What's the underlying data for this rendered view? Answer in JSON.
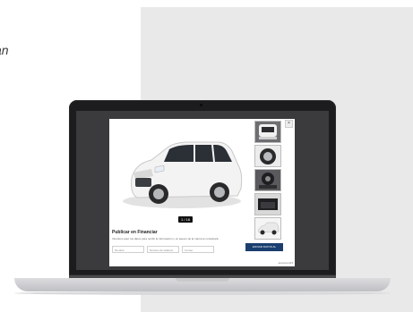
{
  "side_text": "an",
  "modal": {
    "counter": "1 / 18",
    "title": "Publicar en Financiar",
    "subtitle": "Introduce aquí tus datos para recibir la información y un asesor de la marca te contactará",
    "fields": [
      "Nombre",
      "Número de teléfono",
      "Correo"
    ],
    "cta_label": "ENVIAR DATOS AL CONCESIONARIO",
    "close_label": "×",
    "footer": "autoscout24"
  },
  "colors": {
    "cta": "#1a3f6f",
    "vehicle": "#f4f4f4",
    "screen_bg": "#3b3b3d"
  }
}
